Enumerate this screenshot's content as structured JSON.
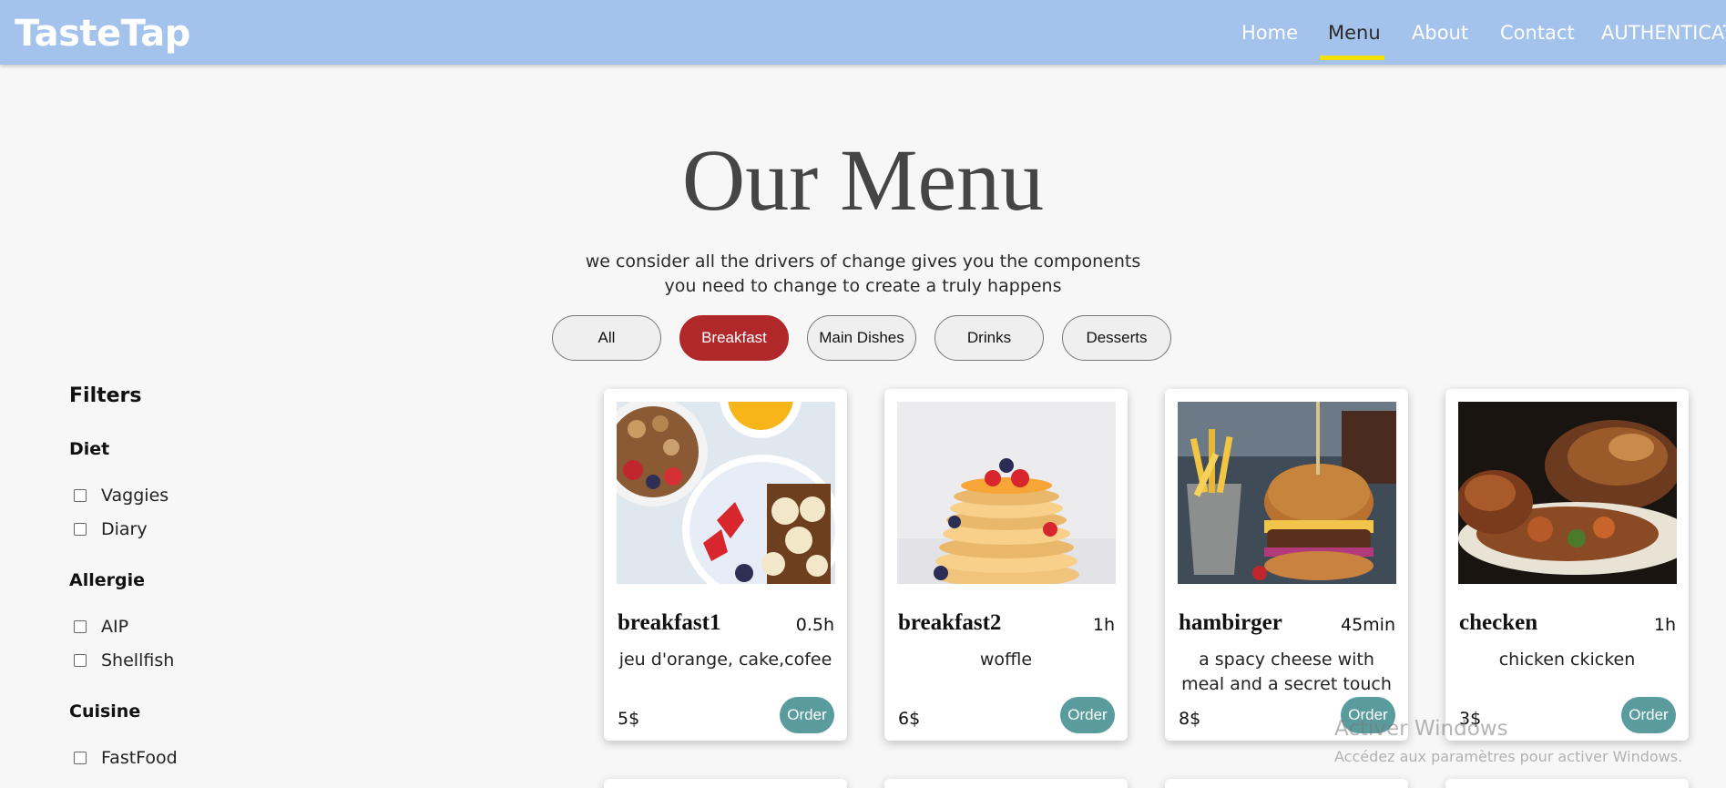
{
  "header": {
    "logo": "TasteTap",
    "nav": [
      "Home",
      "Menu",
      "About",
      "Contact",
      "AUTHENTICATE"
    ],
    "active_nav": "Menu"
  },
  "hero": {
    "title": "Our Menu",
    "subtitle_line1": "we consider all the drivers of change gives you the components",
    "subtitle_line2": "you need to change to create a truly happens"
  },
  "categories": [
    "All",
    "Breakfast",
    "Main Dishes",
    "Drinks",
    "Desserts"
  ],
  "active_category": "Breakfast",
  "filters": {
    "title": "Filters",
    "groups": [
      {
        "title": "Diet",
        "options": [
          "Vaggies",
          "Diary"
        ]
      },
      {
        "title": "Allergie",
        "options": [
          "AIP",
          "Shellfish"
        ]
      },
      {
        "title": "Cuisine",
        "options": [
          "FastFood"
        ]
      }
    ]
  },
  "cards": [
    {
      "name": "breakfast1",
      "time": "0.5h",
      "desc": "jeu d'orange, cake,cofee",
      "price": "5$",
      "order": "Order",
      "image": "breakfast-bowl-image"
    },
    {
      "name": "breakfast2",
      "time": "1h",
      "desc": "woffle",
      "price": "6$",
      "order": "Order",
      "image": "pancake-stack-image"
    },
    {
      "name": "hambirger",
      "time": "45min",
      "desc": "a spacy cheese with meal and a secret touch",
      "price": "8$",
      "order": "Order",
      "image": "burger-fries-image"
    },
    {
      "name": "checken",
      "time": "1h",
      "desc": "chicken ckicken",
      "price": "3$",
      "order": "Order",
      "image": "roast-chicken-image"
    }
  ],
  "watermark": {
    "title": "Activer Windows",
    "subtitle": "Accédez aux paramètres pour activer Windows."
  },
  "colors": {
    "header_bg": "#a4c3ec",
    "nav_active_underline": "#f2e200",
    "pill_active": "#b1282a",
    "order_button": "#5a9b9e",
    "page_bg": "#f7f7f7"
  }
}
